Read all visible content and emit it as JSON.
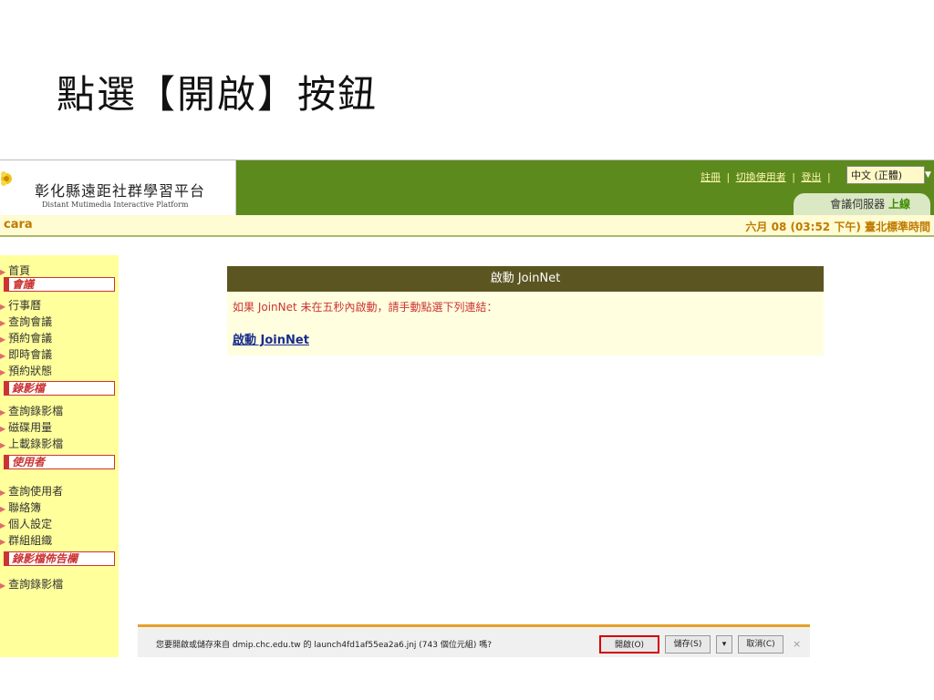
{
  "slide": {
    "title": "點選【開啟】按鈕"
  },
  "header": {
    "logo_cn": "彰化縣遠距社群學習平台",
    "logo_en": "Distant Mutimedia Interactive Platform",
    "links": {
      "register": "註冊",
      "switch_user": "切換使用者",
      "logout": "登出",
      "sep": "|"
    },
    "language": "中文 (正體)",
    "server_label": "會議伺服器",
    "server_status": "上線"
  },
  "user_bar": {
    "username": "cara",
    "datetime": "六月 08 (03:52 下午) 臺北標準時間"
  },
  "sidebar": {
    "home": "首頁",
    "sections": [
      {
        "title": "會議",
        "items": [
          "行事曆",
          "查詢會議",
          "預約會議",
          "即時會議",
          "預約狀態"
        ]
      },
      {
        "title": "錄影檔",
        "items": [
          "查詢錄影檔",
          "磁碟用量",
          "上載錄影檔"
        ]
      },
      {
        "title": "使用者",
        "items": [
          "查詢使用者",
          "聯絡簿",
          "個人設定",
          "群組組織"
        ]
      },
      {
        "title": "錄影檔佈告欄",
        "items": [
          "查詢錄影檔"
        ]
      }
    ]
  },
  "main": {
    "panel_title": "啟動 JoinNet",
    "message": "如果 JoinNet 未在五秒內啟動，請手動點選下列連結：",
    "link": "啟動 JoinNet"
  },
  "download_bar": {
    "prompt": "您要開啟或儲存來自 dmip.chc.edu.tw 的 launch4fd1af55ea2a6.jnj (743 個位元組) 嗎?",
    "open_button": "開啟(O)",
    "save_button": "儲存(S)",
    "dropdown": "▾",
    "cancel_button": "取消(C)",
    "close": "×"
  },
  "colors": {
    "header_green": "#5c8a1d",
    "sidebar_yellow": "#ffff9c",
    "panel_olive": "#5b5521",
    "highlight_red": "#d40000"
  }
}
